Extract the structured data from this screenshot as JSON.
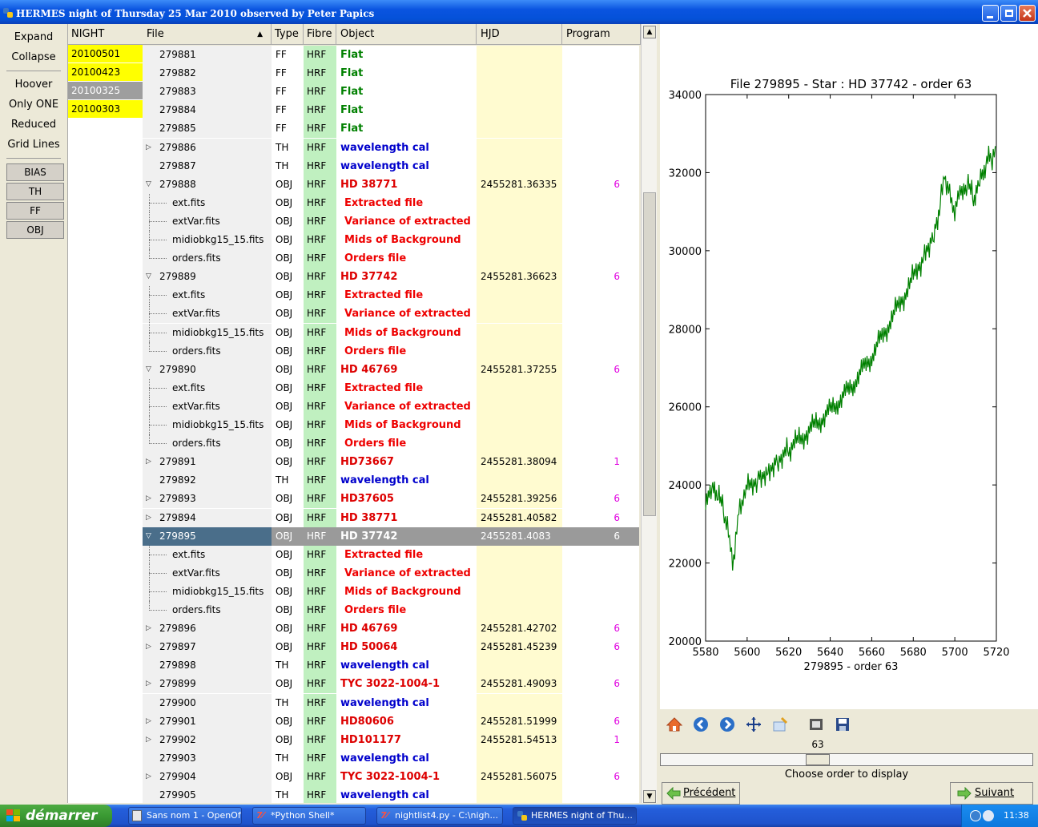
{
  "window": {
    "title": "HERMES night of Thursday 25 Mar 2010 observed by Peter Papics"
  },
  "left": {
    "buttons": [
      "Expand",
      "Collapse",
      "Hoover",
      "Only ONE",
      "Reduced",
      "Grid Lines"
    ],
    "types": [
      "BIAS",
      "TH",
      "FF",
      "OBJ"
    ]
  },
  "headers": {
    "night": "NIGHT",
    "file": "File",
    "type": "Type",
    "fibre": "Fibre",
    "object": "Object",
    "hjd": "HJD",
    "program": "Program"
  },
  "nights": [
    {
      "label": "20100501",
      "selected": false
    },
    {
      "label": "20100423",
      "selected": false
    },
    {
      "label": "20100325",
      "selected": true
    },
    {
      "label": "20100303",
      "selected": false
    }
  ],
  "rows": [
    {
      "file": "279881",
      "type": "FF",
      "fibre": "HRF",
      "object": "Flat",
      "hjd": "",
      "prog": "",
      "kind": "top",
      "arrow": "",
      "color": "#008000"
    },
    {
      "file": "279882",
      "type": "FF",
      "fibre": "HRF",
      "object": "Flat",
      "hjd": "",
      "prog": "",
      "kind": "top",
      "arrow": "",
      "color": "#008000"
    },
    {
      "file": "279883",
      "type": "FF",
      "fibre": "HRF",
      "object": "Flat",
      "hjd": "",
      "prog": "",
      "kind": "top",
      "arrow": "",
      "color": "#008000"
    },
    {
      "file": "279884",
      "type": "FF",
      "fibre": "HRF",
      "object": "Flat",
      "hjd": "",
      "prog": "",
      "kind": "top",
      "arrow": "",
      "color": "#008000"
    },
    {
      "file": "279885",
      "type": "FF",
      "fibre": "HRF",
      "object": "Flat",
      "hjd": "",
      "prog": "",
      "kind": "top",
      "arrow": "",
      "color": "#008000"
    },
    {
      "file": "279886",
      "type": "TH",
      "fibre": "HRF",
      "object": "wavelength cal",
      "hjd": "",
      "prog": "",
      "kind": "top",
      "arrow": "right",
      "color": "#0000cc"
    },
    {
      "file": "279887",
      "type": "TH",
      "fibre": "HRF",
      "object": "wavelength cal",
      "hjd": "",
      "prog": "",
      "kind": "top",
      "arrow": "",
      "color": "#0000cc"
    },
    {
      "file": "279888",
      "type": "OBJ",
      "fibre": "HRF",
      "object": "HD 38771",
      "hjd": "2455281.36335",
      "prog": "6",
      "kind": "top",
      "arrow": "down",
      "color": "#dd0000"
    },
    {
      "file": "ext.fits",
      "type": "OBJ",
      "fibre": "HRF",
      "object": "Extracted file",
      "hjd": "",
      "prog": "",
      "kind": "child",
      "arrow": "",
      "color": "#ee0000"
    },
    {
      "file": "extVar.fits",
      "type": "OBJ",
      "fibre": "HRF",
      "object": "Variance of extracted",
      "hjd": "",
      "prog": "",
      "kind": "child",
      "arrow": "",
      "color": "#ee0000"
    },
    {
      "file": "midiobkg15_15.fits",
      "type": "OBJ",
      "fibre": "HRF",
      "object": "Mids of Background",
      "hjd": "",
      "prog": "",
      "kind": "child",
      "arrow": "",
      "color": "#ee0000"
    },
    {
      "file": "orders.fits",
      "type": "OBJ",
      "fibre": "HRF",
      "object": "Orders file",
      "hjd": "",
      "prog": "",
      "kind": "last",
      "arrow": "",
      "color": "#ee0000"
    },
    {
      "file": "279889",
      "type": "OBJ",
      "fibre": "HRF",
      "object": "HD 37742",
      "hjd": "2455281.36623",
      "prog": "6",
      "kind": "top",
      "arrow": "down",
      "color": "#dd0000"
    },
    {
      "file": "ext.fits",
      "type": "OBJ",
      "fibre": "HRF",
      "object": "Extracted file",
      "hjd": "",
      "prog": "",
      "kind": "child",
      "arrow": "",
      "color": "#ee0000"
    },
    {
      "file": "extVar.fits",
      "type": "OBJ",
      "fibre": "HRF",
      "object": "Variance of extracted",
      "hjd": "",
      "prog": "",
      "kind": "child",
      "arrow": "",
      "color": "#ee0000"
    },
    {
      "file": "midiobkg15_15.fits",
      "type": "OBJ",
      "fibre": "HRF",
      "object": "Mids of Background",
      "hjd": "",
      "prog": "",
      "kind": "child",
      "arrow": "",
      "color": "#ee0000"
    },
    {
      "file": "orders.fits",
      "type": "OBJ",
      "fibre": "HRF",
      "object": "Orders file",
      "hjd": "",
      "prog": "",
      "kind": "last",
      "arrow": "",
      "color": "#ee0000"
    },
    {
      "file": "279890",
      "type": "OBJ",
      "fibre": "HRF",
      "object": "HD 46769",
      "hjd": "2455281.37255",
      "prog": "6",
      "kind": "top",
      "arrow": "down",
      "color": "#dd0000"
    },
    {
      "file": "ext.fits",
      "type": "OBJ",
      "fibre": "HRF",
      "object": "Extracted file",
      "hjd": "",
      "prog": "",
      "kind": "child",
      "arrow": "",
      "color": "#ee0000"
    },
    {
      "file": "extVar.fits",
      "type": "OBJ",
      "fibre": "HRF",
      "object": "Variance of extracted",
      "hjd": "",
      "prog": "",
      "kind": "child",
      "arrow": "",
      "color": "#ee0000"
    },
    {
      "file": "midiobkg15_15.fits",
      "type": "OBJ",
      "fibre": "HRF",
      "object": "Mids of Background",
      "hjd": "",
      "prog": "",
      "kind": "child",
      "arrow": "",
      "color": "#ee0000"
    },
    {
      "file": "orders.fits",
      "type": "OBJ",
      "fibre": "HRF",
      "object": "Orders file",
      "hjd": "",
      "prog": "",
      "kind": "last",
      "arrow": "",
      "color": "#ee0000"
    },
    {
      "file": "279891",
      "type": "OBJ",
      "fibre": "HRF",
      "object": "HD73667",
      "hjd": "2455281.38094",
      "prog": "1",
      "kind": "top",
      "arrow": "right",
      "color": "#dd0000"
    },
    {
      "file": "279892",
      "type": "TH",
      "fibre": "HRF",
      "object": "wavelength cal",
      "hjd": "",
      "prog": "",
      "kind": "top",
      "arrow": "",
      "color": "#0000cc"
    },
    {
      "file": "279893",
      "type": "OBJ",
      "fibre": "HRF",
      "object": "HD37605",
      "hjd": "2455281.39256",
      "prog": "6",
      "kind": "top",
      "arrow": "right",
      "color": "#dd0000"
    },
    {
      "file": "279894",
      "type": "OBJ",
      "fibre": "HRF",
      "object": "HD 38771",
      "hjd": "2455281.40582",
      "prog": "6",
      "kind": "top",
      "arrow": "right",
      "color": "#dd0000"
    },
    {
      "file": "279895",
      "type": "OBJ",
      "fibre": "HRF",
      "object": "HD 37742",
      "hjd": "2455281.4083",
      "prog": "6",
      "kind": "top",
      "arrow": "down",
      "color": "#ffffff",
      "selected": true
    },
    {
      "file": "ext.fits",
      "type": "OBJ",
      "fibre": "HRF",
      "object": "Extracted file",
      "hjd": "",
      "prog": "",
      "kind": "child",
      "arrow": "",
      "color": "#ee0000"
    },
    {
      "file": "extVar.fits",
      "type": "OBJ",
      "fibre": "HRF",
      "object": "Variance of extracted",
      "hjd": "",
      "prog": "",
      "kind": "child",
      "arrow": "",
      "color": "#ee0000"
    },
    {
      "file": "midiobkg15_15.fits",
      "type": "OBJ",
      "fibre": "HRF",
      "object": "Mids of Background",
      "hjd": "",
      "prog": "",
      "kind": "child",
      "arrow": "",
      "color": "#ee0000"
    },
    {
      "file": "orders.fits",
      "type": "OBJ",
      "fibre": "HRF",
      "object": "Orders file",
      "hjd": "",
      "prog": "",
      "kind": "last",
      "arrow": "",
      "color": "#ee0000"
    },
    {
      "file": "279896",
      "type": "OBJ",
      "fibre": "HRF",
      "object": "HD 46769",
      "hjd": "2455281.42702",
      "prog": "6",
      "kind": "top",
      "arrow": "right",
      "color": "#dd0000"
    },
    {
      "file": "279897",
      "type": "OBJ",
      "fibre": "HRF",
      "object": "HD 50064",
      "hjd": "2455281.45239",
      "prog": "6",
      "kind": "top",
      "arrow": "right",
      "color": "#dd0000"
    },
    {
      "file": "279898",
      "type": "TH",
      "fibre": "HRF",
      "object": "wavelength cal",
      "hjd": "",
      "prog": "",
      "kind": "top",
      "arrow": "",
      "color": "#0000cc"
    },
    {
      "file": "279899",
      "type": "OBJ",
      "fibre": "HRF",
      "object": "TYC 3022-1004-1",
      "hjd": "2455281.49093",
      "prog": "6",
      "kind": "top",
      "arrow": "right",
      "color": "#dd0000"
    },
    {
      "file": "279900",
      "type": "TH",
      "fibre": "HRF",
      "object": "wavelength cal",
      "hjd": "",
      "prog": "",
      "kind": "top",
      "arrow": "",
      "color": "#0000cc"
    },
    {
      "file": "279901",
      "type": "OBJ",
      "fibre": "HRF",
      "object": "HD80606",
      "hjd": "2455281.51999",
      "prog": "6",
      "kind": "top",
      "arrow": "right",
      "color": "#dd0000"
    },
    {
      "file": "279902",
      "type": "OBJ",
      "fibre": "HRF",
      "object": "HD101177",
      "hjd": "2455281.54513",
      "prog": "1",
      "kind": "top",
      "arrow": "right",
      "color": "#dd0000"
    },
    {
      "file": "279903",
      "type": "TH",
      "fibre": "HRF",
      "object": "wavelength cal",
      "hjd": "",
      "prog": "",
      "kind": "top",
      "arrow": "",
      "color": "#0000cc"
    },
    {
      "file": "279904",
      "type": "OBJ",
      "fibre": "HRF",
      "object": "TYC 3022-1004-1",
      "hjd": "2455281.56075",
      "prog": "6",
      "kind": "top",
      "arrow": "right",
      "color": "#dd0000"
    },
    {
      "file": "279905",
      "type": "TH",
      "fibre": "HRF",
      "object": "wavelength cal",
      "hjd": "",
      "prog": "",
      "kind": "top",
      "arrow": "",
      "color": "#0000cc"
    }
  ],
  "chart_data": {
    "type": "line",
    "title": "File 279895 - Star : HD 37742 - order 63",
    "xlabel": "279895 - order 63",
    "ylabel": "",
    "xlim": [
      5580,
      5720
    ],
    "ylim": [
      20000,
      34000
    ],
    "xticks": [
      5580,
      5600,
      5620,
      5640,
      5660,
      5680,
      5700,
      5720
    ],
    "yticks": [
      20000,
      22000,
      24000,
      26000,
      28000,
      30000,
      32000,
      34000
    ],
    "grid": false,
    "color": "#008000",
    "series": [
      {
        "x": [
          5580,
          5583,
          5586,
          5589,
          5591,
          5593,
          5594,
          5596,
          5598,
          5600,
          5605,
          5610,
          5615,
          5620,
          5630,
          5640,
          5650,
          5660,
          5670,
          5680,
          5685,
          5690,
          5693,
          5695,
          5697,
          5699,
          5701,
          5703,
          5706,
          5709,
          5712,
          5715,
          5718,
          5720
        ],
        "y": [
          23700,
          24000,
          23700,
          23300,
          22700,
          22100,
          22300,
          23300,
          23700,
          23900,
          24200,
          24400,
          24700,
          24900,
          25400,
          25900,
          26500,
          27300,
          28300,
          29300,
          29900,
          30500,
          31200,
          32000,
          31500,
          31100,
          31200,
          31500,
          31700,
          31300,
          31900,
          32200,
          32400,
          32500
        ]
      }
    ]
  },
  "plot_toolbar": {
    "icons": [
      "home-icon",
      "back-icon",
      "forward-icon",
      "pan-icon",
      "zoom-icon",
      "subplots-icon",
      "save-icon"
    ]
  },
  "order": {
    "value": "63",
    "min": 1,
    "max": 150,
    "current": 63,
    "label": "Choose order to display"
  },
  "nav": {
    "prev": "Précédent",
    "next": "Suivant"
  },
  "taskbar": {
    "start": "démarrer",
    "tasks": [
      "Sans nom 1 - OpenOf...",
      "*Python Shell*",
      "nightlist4.py - C:\\nigh...",
      "HERMES night of Thu..."
    ],
    "clock": "11:38"
  }
}
